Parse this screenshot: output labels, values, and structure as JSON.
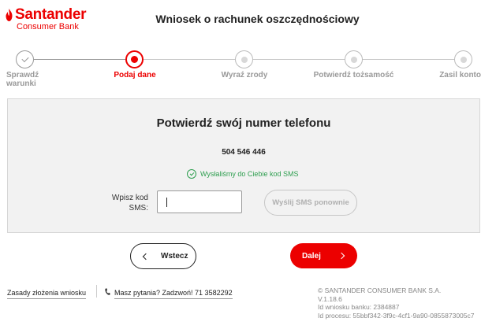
{
  "brand": {
    "name": "Santander",
    "sub": "Consumer Bank",
    "color": "#ec0000"
  },
  "header": {
    "title": "Wniosek o rachunek oszczędnościowy"
  },
  "steps": [
    {
      "label": "Sprawdź warunki",
      "state": "done"
    },
    {
      "label": "Podaj dane",
      "state": "active"
    },
    {
      "label": "Wyraź zrody",
      "state": "pending"
    },
    {
      "label": "Potwierdź tożsamość",
      "state": "pending"
    },
    {
      "label": "Zasil konto",
      "state": "pending"
    }
  ],
  "panel": {
    "title": "Potwierdź swój numer telefonu",
    "phone_number": "504 546 446",
    "sent_message": "Wysłaliśmy do Ciebie kod SMS",
    "code_label": "Wpisz kod SMS:",
    "code_value": "",
    "resend_label": "Wyślij SMS ponownie"
  },
  "nav": {
    "back_label": "Wstecz",
    "next_label": "Dalej"
  },
  "footer": {
    "rules_link": "Zasady złożenia wniosku",
    "contact_link": "Masz pytania? Zadzwoń! 71 3582292",
    "copyright": "© SANTANDER CONSUMER BANK S.A.",
    "version": "V.1.18.6",
    "app_id": "Id wniosku banku: 2384887",
    "process_id": "Id procesu: 55bbf342-3f9c-4cf1-9a90-0855873005c7"
  },
  "icons": {
    "done_step": "check-icon",
    "sent": "check-circle-icon",
    "back": "chevron-left-icon",
    "next": "chevron-right-icon",
    "phone": "phone-icon"
  }
}
